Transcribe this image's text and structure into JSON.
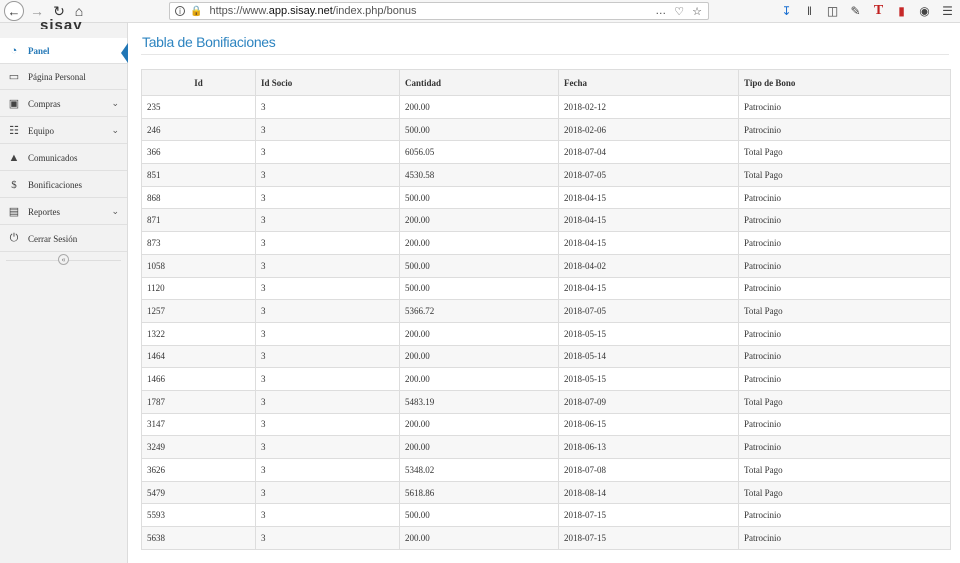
{
  "browser": {
    "url_prefix": "https://www.",
    "url_domain": "app.sisay.net",
    "url_path": "/index.php/bonus"
  },
  "sidebar": {
    "logo": "sisay",
    "items": [
      {
        "label": "Panel",
        "icon": "dashboard-icon",
        "active": true
      },
      {
        "label": "Página Personal",
        "icon": "monitor-icon"
      },
      {
        "label": "Compras",
        "icon": "cart-icon",
        "expandable": true
      },
      {
        "label": "Equipo",
        "icon": "sitemap-icon",
        "expandable": true
      },
      {
        "label": "Comunicados",
        "icon": "megaphone-icon"
      },
      {
        "label": "Bonificaciones",
        "icon": "dollar-icon"
      },
      {
        "label": "Reportes",
        "icon": "report-icon",
        "expandable": true
      },
      {
        "label": "Cerrar Sesión",
        "icon": "power-icon"
      }
    ]
  },
  "main": {
    "title": "Tabla de Bonifiaciones",
    "table": {
      "headers": [
        "Id",
        "Id Socio",
        "Cantidad",
        "Fecha",
        "Tipo de Bono"
      ],
      "rows": [
        [
          "235",
          "3",
          "200.00",
          "2018-02-12",
          "Patrocinio"
        ],
        [
          "246",
          "3",
          "500.00",
          "2018-02-06",
          "Patrocinio"
        ],
        [
          "366",
          "3",
          "6056.05",
          "2018-07-04",
          "Total Pago"
        ],
        [
          "851",
          "3",
          "4530.58",
          "2018-07-05",
          "Total Pago"
        ],
        [
          "868",
          "3",
          "500.00",
          "2018-04-15",
          "Patrocinio"
        ],
        [
          "871",
          "3",
          "200.00",
          "2018-04-15",
          "Patrocinio"
        ],
        [
          "873",
          "3",
          "200.00",
          "2018-04-15",
          "Patrocinio"
        ],
        [
          "1058",
          "3",
          "500.00",
          "2018-04-02",
          "Patrocinio"
        ],
        [
          "1120",
          "3",
          "500.00",
          "2018-04-15",
          "Patrocinio"
        ],
        [
          "1257",
          "3",
          "5366.72",
          "2018-07-05",
          "Total Pago"
        ],
        [
          "1322",
          "3",
          "200.00",
          "2018-05-15",
          "Patrocinio"
        ],
        [
          "1464",
          "3",
          "200.00",
          "2018-05-14",
          "Patrocinio"
        ],
        [
          "1466",
          "3",
          "200.00",
          "2018-05-15",
          "Patrocinio"
        ],
        [
          "1787",
          "3",
          "5483.19",
          "2018-07-09",
          "Total Pago"
        ],
        [
          "3147",
          "3",
          "200.00",
          "2018-06-15",
          "Patrocinio"
        ],
        [
          "3249",
          "3",
          "200.00",
          "2018-06-13",
          "Patrocinio"
        ],
        [
          "3626",
          "3",
          "5348.02",
          "2018-07-08",
          "Total Pago"
        ],
        [
          "5479",
          "3",
          "5618.86",
          "2018-08-14",
          "Total Pago"
        ],
        [
          "5593",
          "3",
          "500.00",
          "2018-07-15",
          "Patrocinio"
        ],
        [
          "5638",
          "3",
          "200.00",
          "2018-07-15",
          "Patrocinio"
        ]
      ]
    }
  },
  "colors": {
    "accent": "#2277b6",
    "title": "#2d84c0"
  }
}
